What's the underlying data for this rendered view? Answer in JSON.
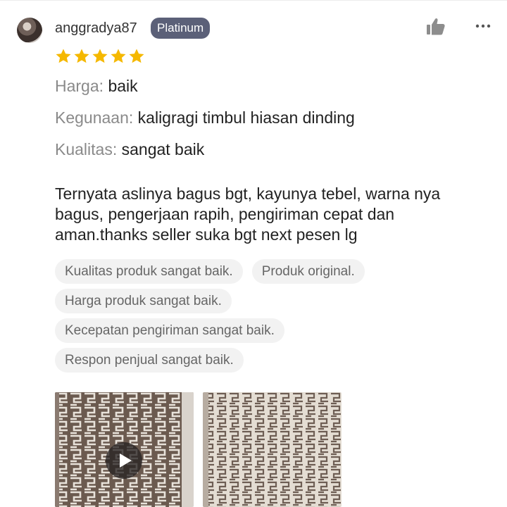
{
  "review": {
    "username": "anggradya87",
    "badge": "Platinum",
    "rating": 5,
    "attributes": [
      {
        "label": "Harga:",
        "value": "baik"
      },
      {
        "label": "Kegunaan:",
        "value": "kaligragi timbul hiasan dinding"
      },
      {
        "label": "Kualitas:",
        "value": "sangat baik"
      }
    ],
    "text": "Ternyata aslinya bagus bgt, kayunya tebel, warna nya bagus, pengerjaan rapih, pengiriman cepat dan aman.thanks seller suka bgt next pesen lg",
    "tags": [
      "Kualitas produk sangat baik.",
      "Produk original.",
      "Harga produk sangat baik.",
      "Kecepatan pengiriman sangat baik.",
      "Respon penjual sangat baik."
    ]
  },
  "icons": {
    "like": "thumbs-up-icon",
    "more": "more-dots-icon",
    "star": "star-icon",
    "play": "play-icon"
  },
  "colors": {
    "badge_bg": "#5b6078",
    "star": "#f5b800",
    "tag_bg": "#f2f2f2",
    "label": "#8a8a8a"
  }
}
